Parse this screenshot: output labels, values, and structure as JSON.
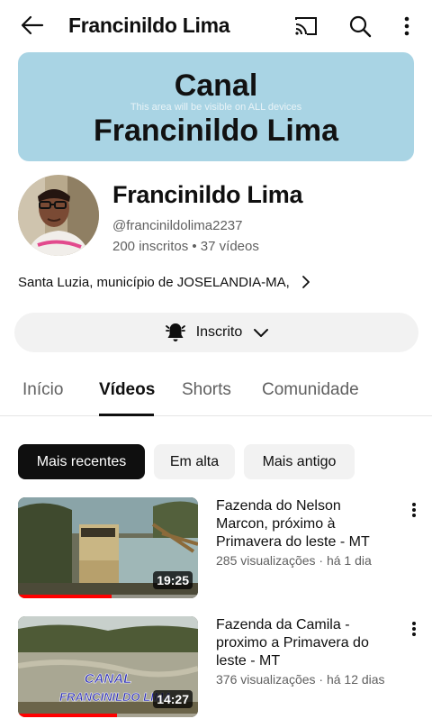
{
  "header": {
    "title": "Francinildo Lima",
    "back_icon": "arrow-left-icon",
    "cast_icon": "cast-icon",
    "search_icon": "search-icon",
    "more_icon": "more-vert-icon"
  },
  "banner": {
    "line1": "Canal",
    "line2": "Francinildo Lima",
    "safe_area_text": "This area will be visible on ALL devices",
    "background": "#a9d4e4"
  },
  "channel": {
    "name": "Francinildo Lima",
    "handle": "@francinildolima2237",
    "stats": "200 inscritos • 37 vídeos",
    "description": "Santa Luzia, município de JOSELANDIA-MA,"
  },
  "subscribe": {
    "label": "Inscrito",
    "bell_icon": "bell-icon",
    "chevron_icon": "chevron-down-icon"
  },
  "tabs": [
    {
      "label": "Início",
      "active": false
    },
    {
      "label": "Vídeos",
      "active": true
    },
    {
      "label": "Shorts",
      "active": false
    },
    {
      "label": "Comunidade",
      "active": false
    }
  ],
  "filters": [
    {
      "label": "Mais recentes",
      "selected": true
    },
    {
      "label": "Em alta",
      "selected": false
    },
    {
      "label": "Mais antigo",
      "selected": false
    }
  ],
  "videos": [
    {
      "title": "Fazenda do Nelson Marcon, próximo à Primavera do leste  - MT",
      "meta": "285 visualizações · há 1 dia",
      "duration": "19:25",
      "watched_fraction": 0.52
    },
    {
      "title": "Fazenda da Camila  - proximo a Primavera do leste  -  MT",
      "meta": "376 visualizações · há 12 dias",
      "duration": "14:27",
      "watched_fraction": 0.55,
      "thumb_text_line1": "CANAL",
      "thumb_text_line2": "FRANCINILDO LIMA"
    }
  ],
  "colors": {
    "accent": "#ff0000",
    "text_primary": "#0f0f0f",
    "text_secondary": "#606060",
    "chip_bg": "#f2f2f2"
  }
}
